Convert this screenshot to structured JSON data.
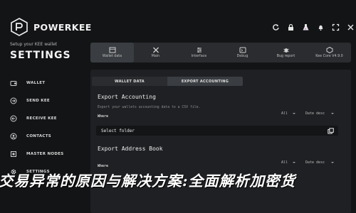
{
  "brand": {
    "name": "POWERKEE"
  },
  "sidebar": {
    "caption": "Setup your KEE wallet",
    "heading": "SETTINGS",
    "items": [
      {
        "label": "WALLET",
        "icon": "wallet-icon"
      },
      {
        "label": "SEND KEE",
        "icon": "send-icon"
      },
      {
        "label": "RECEIVE KEE",
        "icon": "receive-icon"
      },
      {
        "label": "CONTACTS",
        "icon": "contacts-icon"
      },
      {
        "label": "MASTER NODES",
        "icon": "nodes-icon"
      },
      {
        "label": "SETTINGS",
        "icon": "gear-icon"
      }
    ]
  },
  "top_icons": [
    "refresh-icon",
    "lock-icon",
    "flask-icon",
    "bell-icon",
    "expand-icon",
    "close-icon"
  ],
  "toolbar": {
    "items": [
      {
        "label": "Wallet data",
        "icon": "wallet-data-icon",
        "active": true
      },
      {
        "label": "Main",
        "icon": "tools-icon",
        "active": false
      },
      {
        "label": "Interface",
        "icon": "interface-icon",
        "active": false
      },
      {
        "label": "Debug",
        "icon": "debug-icon",
        "active": false
      },
      {
        "label": "Bug report",
        "icon": "bug-icon",
        "active": false
      },
      {
        "label": "Kee Core V4.9.0",
        "icon": "core-icon",
        "active": false
      }
    ]
  },
  "panel": {
    "tabs": [
      {
        "label": "WALLET DATA",
        "active": false
      },
      {
        "label": "EXPORT ACCOUNTING",
        "active": true
      }
    ],
    "export_accounting": {
      "title": "Export Accounting",
      "description": "Export your wallets accounting data to a CSV file.",
      "where_label": "Where",
      "filter_all": "All",
      "sort": "Date desc",
      "folder_placeholder": "Select folder"
    },
    "export_address_book": {
      "title": "Export Address Book",
      "where_label": "Where",
      "filter_all": "All",
      "sort": "Date desc"
    }
  },
  "overlay_caption": "交易异常的原因与解决方案:全面解析加密货"
}
